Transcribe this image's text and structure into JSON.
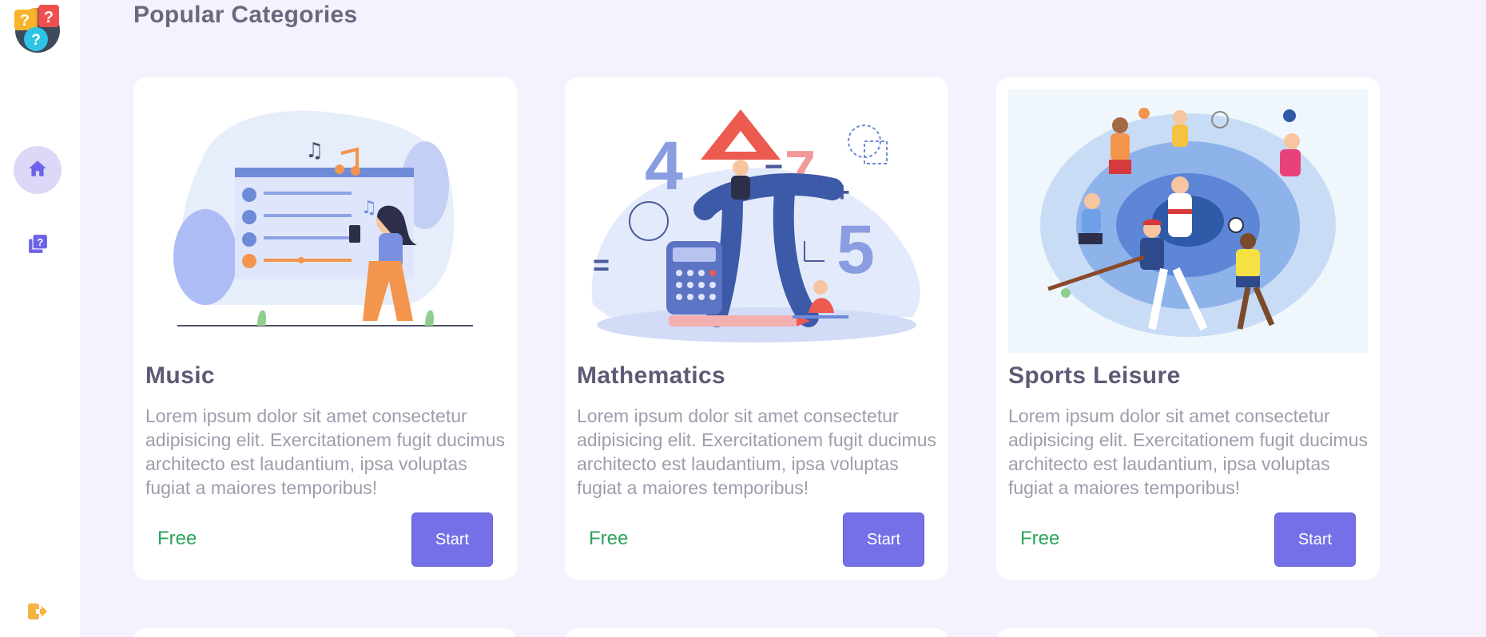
{
  "main": {
    "heading": "Popular Categories"
  },
  "nav": {
    "home_icon": "home-icon",
    "quiz_icon": "quiz-book-icon",
    "logout_icon": "logout-icon",
    "active_color": "#7570e8"
  },
  "cards": [
    {
      "title": "Music",
      "description": "Lorem ipsum dolor sit amet consectetur adipisicing elit. Exercitationem fugit ducimus architecto est laudantium, ipsa voluptas fugiat a maiores temporibus!",
      "price": "Free",
      "button": "Start"
    },
    {
      "title": "Mathematics",
      "description": "Lorem ipsum dolor sit amet consectetur adipisicing elit. Exercitationem fugit ducimus architecto est laudantium, ipsa voluptas fugiat a maiores temporibus!",
      "price": "Free",
      "button": "Start"
    },
    {
      "title": "Sports Leisure",
      "description": "Lorem ipsum dolor sit amet consectetur adipisicing elit. Exercitationem fugit ducimus architecto est laudantium, ipsa voluptas fugiat a maiores temporibus!",
      "price": "Free",
      "button": "Start"
    }
  ],
  "colors": {
    "accent": "#7570e8",
    "free": "#2ba45c",
    "background": "#f5f1fd"
  }
}
